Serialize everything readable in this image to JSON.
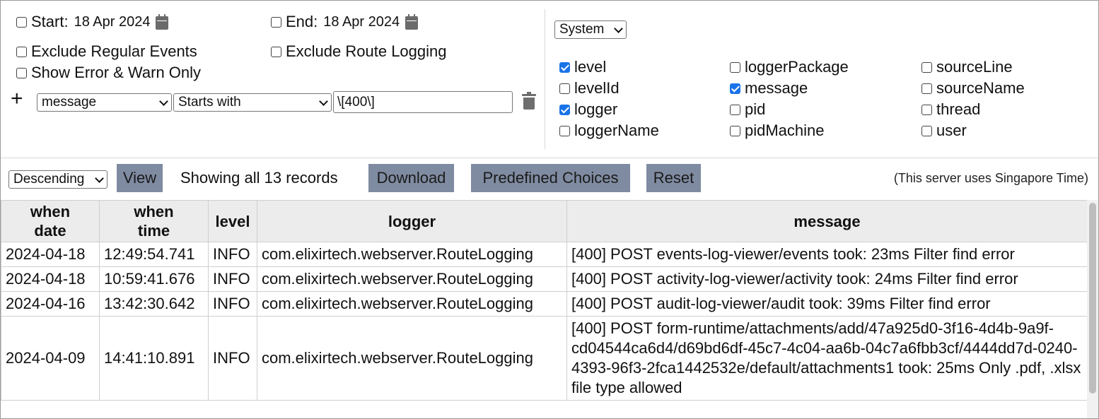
{
  "filters": {
    "start_label": "Start:",
    "start_value": "18 Apr 2024",
    "end_label": "End:",
    "end_value": "18 Apr 2024",
    "exclude_regular": "Exclude Regular Events",
    "exclude_route": "Exclude Route Logging",
    "error_warn": "Show Error & Warn Only",
    "add_symbol": "+",
    "field_value": "message",
    "operator_value": "Starts with",
    "pattern_value": "\\[400\\]"
  },
  "columns_panel": {
    "group_select": "System",
    "items": [
      {
        "label": "level",
        "checked": true
      },
      {
        "label": "levelId",
        "checked": false
      },
      {
        "label": "logger",
        "checked": true
      },
      {
        "label": "loggerName",
        "checked": false
      },
      {
        "label": "loggerPackage",
        "checked": false
      },
      {
        "label": "message",
        "checked": true
      },
      {
        "label": "pid",
        "checked": false
      },
      {
        "label": "pidMachine",
        "checked": false
      },
      {
        "label": "sourceLine",
        "checked": false
      },
      {
        "label": "sourceName",
        "checked": false
      },
      {
        "label": "thread",
        "checked": false
      },
      {
        "label": "user",
        "checked": false
      }
    ]
  },
  "toolbar": {
    "sort_value": "Descending",
    "view": "View",
    "records": "Showing all 13 records",
    "download": "Download",
    "predefined": "Predefined Choices",
    "reset": "Reset",
    "timezone": "(This server uses Singapore Time)"
  },
  "table": {
    "headers": {
      "date_l1": "when",
      "date_l2": "date",
      "time_l1": "when",
      "time_l2": "time",
      "level": "level",
      "logger": "logger",
      "message": "message"
    },
    "rows": [
      {
        "date": "2024-04-18",
        "time": "12:49:54.741",
        "level": "INFO",
        "logger": "com.elixirtech.webserver.RouteLogging",
        "message": "[400] POST events-log-viewer/events took: 23ms Filter find error"
      },
      {
        "date": "2024-04-18",
        "time": "10:59:41.676",
        "level": "INFO",
        "logger": "com.elixirtech.webserver.RouteLogging",
        "message": "[400] POST activity-log-viewer/activity took: 24ms Filter find error"
      },
      {
        "date": "2024-04-16",
        "time": "13:42:30.642",
        "level": "INFO",
        "logger": "com.elixirtech.webserver.RouteLogging",
        "message": "[400] POST audit-log-viewer/audit took: 39ms Filter find error"
      },
      {
        "date": "2024-04-09",
        "time": "14:41:10.891",
        "level": "INFO",
        "logger": "com.elixirtech.webserver.RouteLogging",
        "message": "[400] POST form-runtime/attachments/add/47a925d0-3f16-4d4b-9a9f-cd04544ca6d4/d69bd6df-45c7-4c04-aa6b-04c7a6fbb3cf/4444dd7d-0240-4393-96f3-2fca1442532e/default/attachments1 took: 25ms Only .pdf, .xlsx file type allowed"
      }
    ]
  }
}
